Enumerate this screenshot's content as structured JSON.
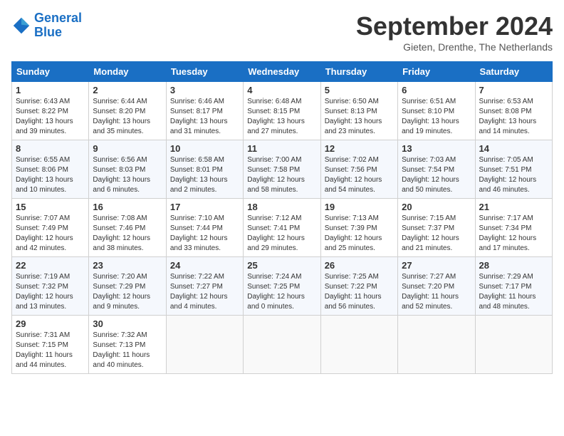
{
  "header": {
    "logo_line1": "General",
    "logo_line2": "Blue",
    "month": "September 2024",
    "location": "Gieten, Drenthe, The Netherlands"
  },
  "days_of_week": [
    "Sunday",
    "Monday",
    "Tuesday",
    "Wednesday",
    "Thursday",
    "Friday",
    "Saturday"
  ],
  "weeks": [
    [
      {
        "day": "1",
        "text": "Sunrise: 6:43 AM\nSunset: 8:22 PM\nDaylight: 13 hours\nand 39 minutes."
      },
      {
        "day": "2",
        "text": "Sunrise: 6:44 AM\nSunset: 8:20 PM\nDaylight: 13 hours\nand 35 minutes."
      },
      {
        "day": "3",
        "text": "Sunrise: 6:46 AM\nSunset: 8:17 PM\nDaylight: 13 hours\nand 31 minutes."
      },
      {
        "day": "4",
        "text": "Sunrise: 6:48 AM\nSunset: 8:15 PM\nDaylight: 13 hours\nand 27 minutes."
      },
      {
        "day": "5",
        "text": "Sunrise: 6:50 AM\nSunset: 8:13 PM\nDaylight: 13 hours\nand 23 minutes."
      },
      {
        "day": "6",
        "text": "Sunrise: 6:51 AM\nSunset: 8:10 PM\nDaylight: 13 hours\nand 19 minutes."
      },
      {
        "day": "7",
        "text": "Sunrise: 6:53 AM\nSunset: 8:08 PM\nDaylight: 13 hours\nand 14 minutes."
      }
    ],
    [
      {
        "day": "8",
        "text": "Sunrise: 6:55 AM\nSunset: 8:06 PM\nDaylight: 13 hours\nand 10 minutes."
      },
      {
        "day": "9",
        "text": "Sunrise: 6:56 AM\nSunset: 8:03 PM\nDaylight: 13 hours\nand 6 minutes."
      },
      {
        "day": "10",
        "text": "Sunrise: 6:58 AM\nSunset: 8:01 PM\nDaylight: 13 hours\nand 2 minutes."
      },
      {
        "day": "11",
        "text": "Sunrise: 7:00 AM\nSunset: 7:58 PM\nDaylight: 12 hours\nand 58 minutes."
      },
      {
        "day": "12",
        "text": "Sunrise: 7:02 AM\nSunset: 7:56 PM\nDaylight: 12 hours\nand 54 minutes."
      },
      {
        "day": "13",
        "text": "Sunrise: 7:03 AM\nSunset: 7:54 PM\nDaylight: 12 hours\nand 50 minutes."
      },
      {
        "day": "14",
        "text": "Sunrise: 7:05 AM\nSunset: 7:51 PM\nDaylight: 12 hours\nand 46 minutes."
      }
    ],
    [
      {
        "day": "15",
        "text": "Sunrise: 7:07 AM\nSunset: 7:49 PM\nDaylight: 12 hours\nand 42 minutes."
      },
      {
        "day": "16",
        "text": "Sunrise: 7:08 AM\nSunset: 7:46 PM\nDaylight: 12 hours\nand 38 minutes."
      },
      {
        "day": "17",
        "text": "Sunrise: 7:10 AM\nSunset: 7:44 PM\nDaylight: 12 hours\nand 33 minutes."
      },
      {
        "day": "18",
        "text": "Sunrise: 7:12 AM\nSunset: 7:41 PM\nDaylight: 12 hours\nand 29 minutes."
      },
      {
        "day": "19",
        "text": "Sunrise: 7:13 AM\nSunset: 7:39 PM\nDaylight: 12 hours\nand 25 minutes."
      },
      {
        "day": "20",
        "text": "Sunrise: 7:15 AM\nSunset: 7:37 PM\nDaylight: 12 hours\nand 21 minutes."
      },
      {
        "day": "21",
        "text": "Sunrise: 7:17 AM\nSunset: 7:34 PM\nDaylight: 12 hours\nand 17 minutes."
      }
    ],
    [
      {
        "day": "22",
        "text": "Sunrise: 7:19 AM\nSunset: 7:32 PM\nDaylight: 12 hours\nand 13 minutes."
      },
      {
        "day": "23",
        "text": "Sunrise: 7:20 AM\nSunset: 7:29 PM\nDaylight: 12 hours\nand 9 minutes."
      },
      {
        "day": "24",
        "text": "Sunrise: 7:22 AM\nSunset: 7:27 PM\nDaylight: 12 hours\nand 4 minutes."
      },
      {
        "day": "25",
        "text": "Sunrise: 7:24 AM\nSunset: 7:25 PM\nDaylight: 12 hours\nand 0 minutes."
      },
      {
        "day": "26",
        "text": "Sunrise: 7:25 AM\nSunset: 7:22 PM\nDaylight: 11 hours\nand 56 minutes."
      },
      {
        "day": "27",
        "text": "Sunrise: 7:27 AM\nSunset: 7:20 PM\nDaylight: 11 hours\nand 52 minutes."
      },
      {
        "day": "28",
        "text": "Sunrise: 7:29 AM\nSunset: 7:17 PM\nDaylight: 11 hours\nand 48 minutes."
      }
    ],
    [
      {
        "day": "29",
        "text": "Sunrise: 7:31 AM\nSunset: 7:15 PM\nDaylight: 11 hours\nand 44 minutes."
      },
      {
        "day": "30",
        "text": "Sunrise: 7:32 AM\nSunset: 7:13 PM\nDaylight: 11 hours\nand 40 minutes."
      },
      {
        "day": "",
        "text": ""
      },
      {
        "day": "",
        "text": ""
      },
      {
        "day": "",
        "text": ""
      },
      {
        "day": "",
        "text": ""
      },
      {
        "day": "",
        "text": ""
      }
    ]
  ]
}
